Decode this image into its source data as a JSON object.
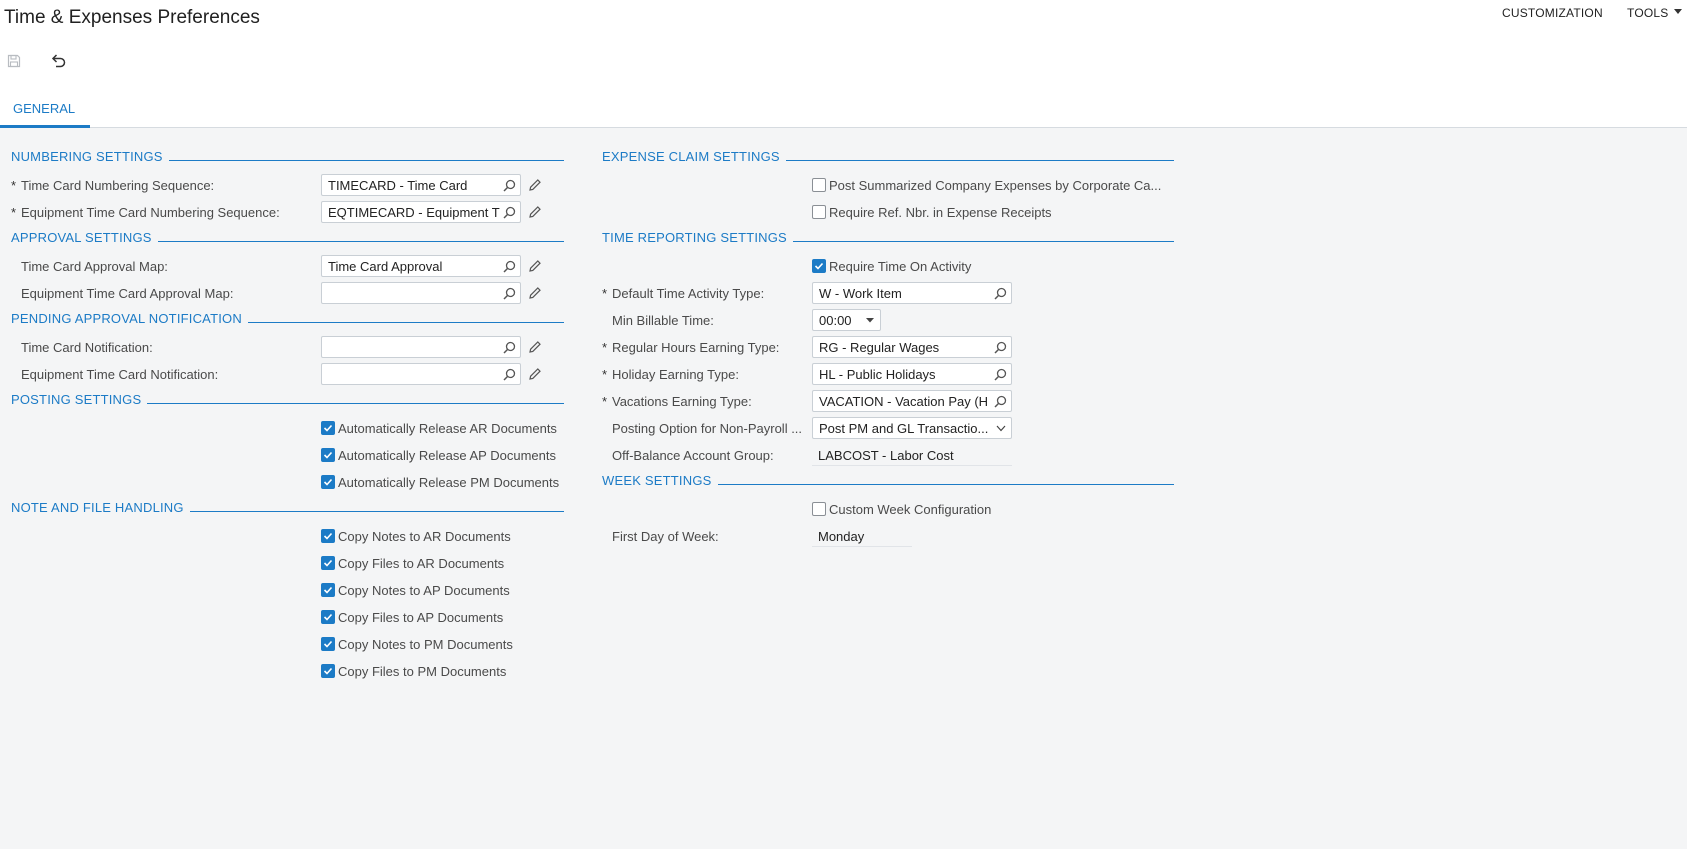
{
  "header": {
    "title": "Time & Expenses Preferences",
    "customization": "CUSTOMIZATION",
    "tools": "TOOLS"
  },
  "toolbar": {
    "save_icon": "save-icon",
    "undo_icon": "undo-icon"
  },
  "tabs": [
    {
      "label": "GENERAL",
      "active": true
    }
  ],
  "colors": {
    "accent": "#1c7bc6",
    "background": "#f4f5f6",
    "header_bg": "#ffffff"
  },
  "numbering": {
    "title": "NUMBERING SETTINGS",
    "timecard_label": "Time Card Numbering Sequence:",
    "timecard_value": "TIMECARD - Time Card",
    "eqtimecard_label": "Equipment Time Card Numbering Sequence:",
    "eqtimecard_value": "EQTIMECARD - Equipment T",
    "required_mark": "*"
  },
  "approval": {
    "title": "APPROVAL SETTINGS",
    "timecard_map_label": "Time Card Approval Map:",
    "timecard_map_value": "Time Card Approval",
    "eq_map_label": "Equipment Time Card Approval Map:",
    "eq_map_value": ""
  },
  "pending": {
    "title": "PENDING APPROVAL NOTIFICATION",
    "timecard_label": "Time Card Notification:",
    "timecard_value": "",
    "eq_label": "Equipment Time Card Notification:",
    "eq_value": ""
  },
  "posting": {
    "title": "POSTING SETTINGS",
    "items": [
      {
        "label": "Automatically Release AR Documents",
        "checked": true
      },
      {
        "label": "Automatically Release AP Documents",
        "checked": true
      },
      {
        "label": "Automatically Release PM Documents",
        "checked": true
      }
    ]
  },
  "notes": {
    "title": "NOTE AND FILE HANDLING",
    "items": [
      {
        "label": "Copy Notes to AR Documents",
        "checked": true
      },
      {
        "label": "Copy Files to AR Documents",
        "checked": true
      },
      {
        "label": "Copy Notes to AP Documents",
        "checked": true
      },
      {
        "label": "Copy Files to AP Documents",
        "checked": true
      },
      {
        "label": "Copy Notes to PM Documents",
        "checked": true
      },
      {
        "label": "Copy Files to PM Documents",
        "checked": true
      }
    ]
  },
  "expense": {
    "title": "EXPENSE CLAIM SETTINGS",
    "items": [
      {
        "label": "Post Summarized Company Expenses by Corporate Ca...",
        "checked": false
      },
      {
        "label": "Require Ref. Nbr. in Expense Receipts",
        "checked": false
      }
    ]
  },
  "time_reporting": {
    "title": "TIME REPORTING SETTINGS",
    "require_time": {
      "label": "Require Time On Activity",
      "checked": true
    },
    "activity_type_label": "Default Time Activity Type:",
    "activity_type_value": "W - Work Item",
    "min_billable_label": "Min Billable Time:",
    "min_billable_value": "00:00",
    "regular_label": "Regular Hours Earning Type:",
    "regular_value": "RG - Regular Wages",
    "holiday_label": "Holiday Earning Type:",
    "holiday_value": "HL - Public Holidays",
    "vacation_label": "Vacations Earning Type:",
    "vacation_value": "VACATION - Vacation Pay (H",
    "posting_option_label": "Posting Option for Non-Payroll ...",
    "posting_option_value": "Post PM and GL Transactio...",
    "offbalance_label": "Off-Balance Account Group:",
    "offbalance_value": "LABCOST - Labor Cost"
  },
  "week": {
    "title": "WEEK SETTINGS",
    "custom": {
      "label": "Custom Week Configuration",
      "checked": false
    },
    "first_day_label": "First Day of Week:",
    "first_day_value": "Monday"
  }
}
